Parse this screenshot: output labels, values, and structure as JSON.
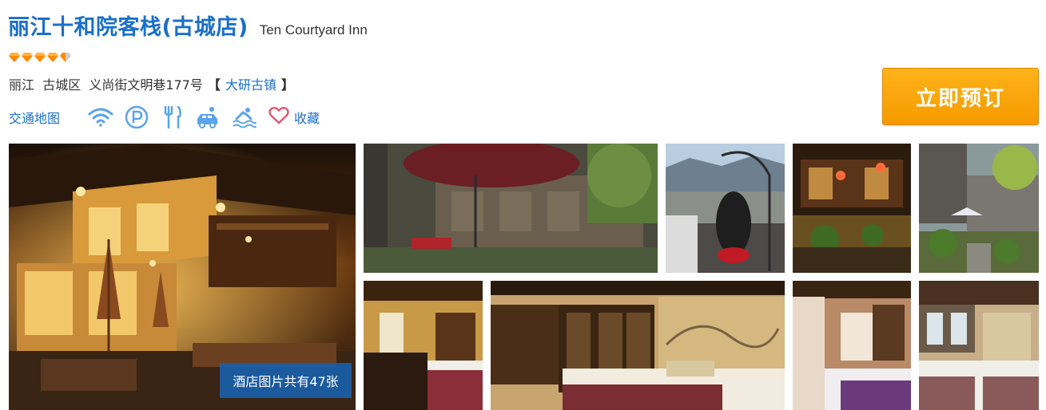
{
  "hotel": {
    "name": "丽江十和院客栈(古城店)",
    "name_en": "Ten Courtyard Inn",
    "rating_diamonds": 4.5,
    "rating_color": "#ff8a00"
  },
  "address": {
    "city": "丽江",
    "district": "古城区",
    "street": "义尚街文明巷177号",
    "bracket_open": "【",
    "area_link": "大研古镇",
    "bracket_close": "】"
  },
  "amenities": {
    "map_link": "交通地图",
    "icons": [
      "wifi-icon",
      "parking-icon",
      "restaurant-icon",
      "airport-shuttle-icon",
      "pool-icon"
    ],
    "favorite_label": "收藏",
    "icon_color": "#5aa4ea",
    "favorite_color": "#e8506a"
  },
  "actions": {
    "book_label": "立即预订",
    "book_color": "#f7a30c"
  },
  "gallery": {
    "photo_count_label": "酒店图片共有47张",
    "photos": [
      "courtyard-night",
      "terrace-umbrella",
      "swing-chair-mountain",
      "courtyard-lanterns",
      "garden-courtyard",
      "room-single-bed",
      "room-double-bed-mural",
      "room-bed-lamp",
      "room-twin-beds"
    ]
  }
}
